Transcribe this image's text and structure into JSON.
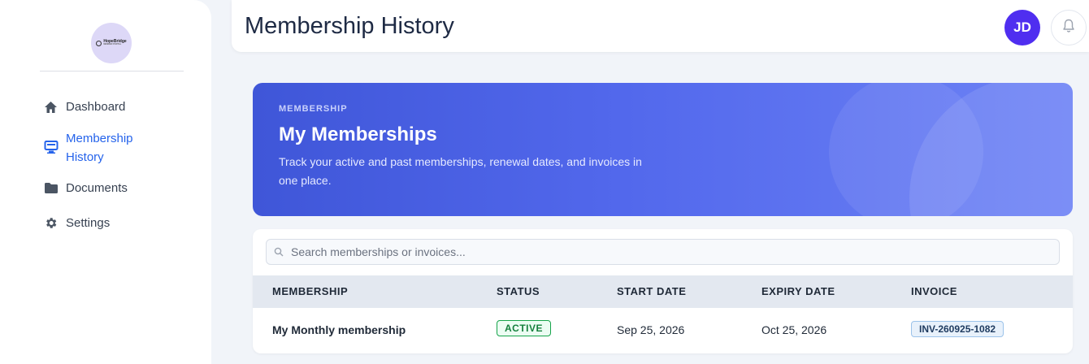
{
  "sidebar": {
    "logo": {
      "name": "HopeBridge",
      "tagline": "MEMBER PORTAL"
    },
    "items": [
      {
        "label": "Dashboard",
        "icon": "home-icon"
      },
      {
        "label": "Membership\nHistory",
        "icon": "monitor-icon",
        "active": true
      },
      {
        "label": "Documents",
        "icon": "folder-icon"
      },
      {
        "label": "Settings",
        "icon": "gear-icon"
      }
    ]
  },
  "header": {
    "title": "Membership History",
    "avatar_initials": "JD",
    "avatar_color": "#4f2ef0",
    "bell_icon": "bell-icon"
  },
  "hero": {
    "eyebrow": "MEMBERSHIP",
    "title": "My Memberships",
    "description": "Track your active and past memberships, renewal dates, and invoices in one place."
  },
  "table": {
    "search_placeholder": "Search memberships or invoices...",
    "columns": [
      "MEMBERSHIP",
      "STATUS",
      "START DATE",
      "EXPIRY DATE",
      "INVOICE"
    ],
    "rows": [
      {
        "membership": "My Monthly membership",
        "status": "ACTIVE",
        "start_date": "Sep 25, 2026",
        "expiry_date": "Oct 25, 2026",
        "invoice": "INV-260925-1082"
      }
    ]
  },
  "colors": {
    "accent": "#2563eb",
    "hero_start": "#3f56d8",
    "hero_end": "#6d82f5",
    "status_active": "#16a34a"
  }
}
